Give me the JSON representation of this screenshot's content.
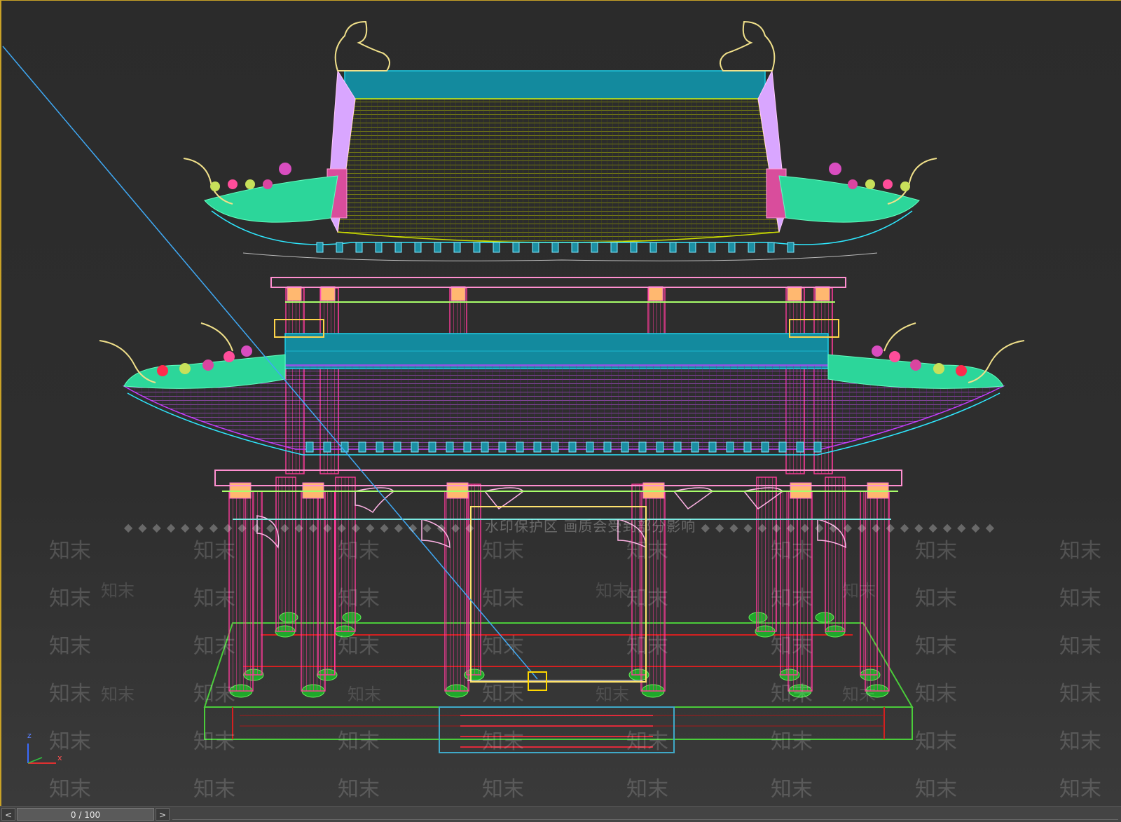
{
  "viewport": {
    "watermark_banner": "水印保护区 画质会受到部分影响",
    "watermark_tile": "知末",
    "axis": {
      "z": "z",
      "x": "x"
    }
  },
  "timeline": {
    "frame_label": "0 / 100",
    "prev_label": "<",
    "next_label": ">"
  },
  "colors": {
    "roof_upper": "#7d8a00",
    "roof_lower": "#a013d6",
    "ridge": "#138a9e",
    "column": "#d4136e",
    "eave_edge": "#45e6a0",
    "ornament": "#f0e08a",
    "selection_line": "#3fa9f5"
  }
}
